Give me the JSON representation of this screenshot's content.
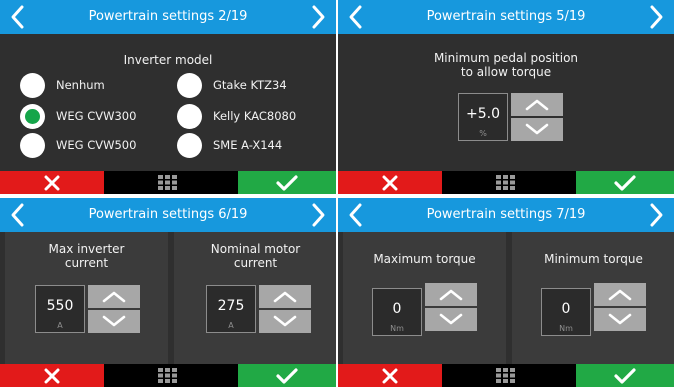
{
  "colors": {
    "titlebar": "#1798dd",
    "cancel": "#e21a1a",
    "confirm": "#21a945",
    "background": "#2f2f2f",
    "selected": "#15a54a"
  },
  "icons": {
    "prev": "chevron-left-icon",
    "next": "chevron-right-icon",
    "cancel": "x-icon",
    "menu": "grid-icon",
    "confirm": "check-icon",
    "up": "chevron-up-icon",
    "down": "chevron-down-icon"
  },
  "screens": [
    {
      "title": "Powertrain settings 2/19",
      "heading": "Inverter model",
      "options": [
        {
          "label": "Nenhum",
          "selected": false
        },
        {
          "label": "WEG CVW300",
          "selected": true
        },
        {
          "label": "WEG CVW500",
          "selected": false
        },
        {
          "label": "Gtake KTZ34",
          "selected": false
        },
        {
          "label": "Kelly KAC8080",
          "selected": false
        },
        {
          "label": "SME A-X144",
          "selected": false
        }
      ]
    },
    {
      "title": "Powertrain settings 5/19",
      "heading_line1": "Minimum pedal position",
      "heading_line2": "to allow torque",
      "value": "+5.0",
      "unit": "%"
    },
    {
      "title": "Powertrain settings 6/19",
      "panels": [
        {
          "label_line1": "Max inverter",
          "label_line2": "current",
          "value": "550",
          "unit": "A"
        },
        {
          "label_line1": "Nominal motor",
          "label_line2": "current",
          "value": "275",
          "unit": "A"
        }
      ]
    },
    {
      "title": "Powertrain settings 7/19",
      "panels": [
        {
          "label": "Maximum torque",
          "value": "0",
          "unit": "Nm"
        },
        {
          "label": "Minimum torque",
          "value": "0",
          "unit": "Nm"
        }
      ]
    }
  ]
}
